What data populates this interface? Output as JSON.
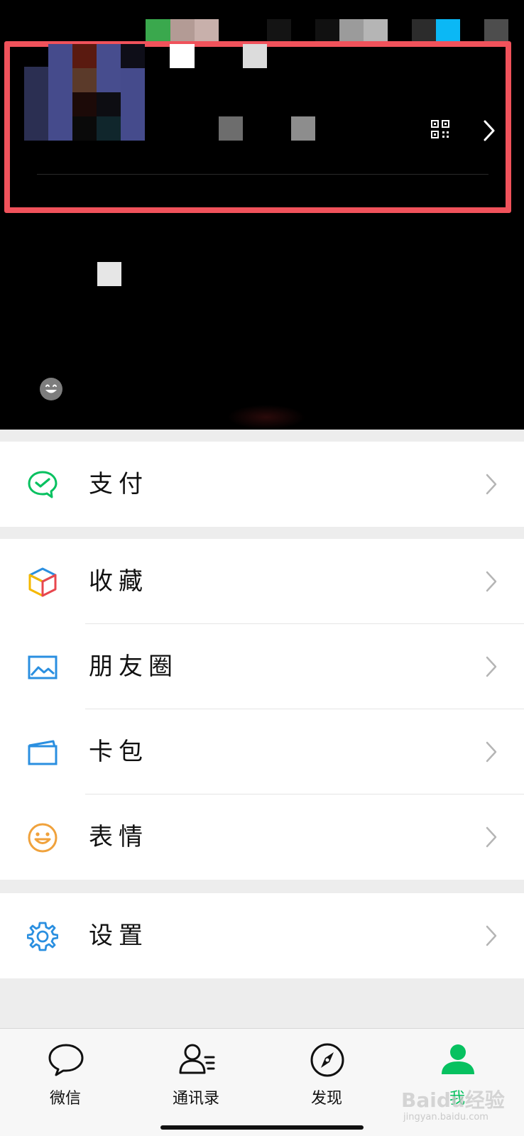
{
  "menu": {
    "pay": {
      "label": "支付",
      "icon": "wechat-pay-icon"
    },
    "favorites": {
      "label": "收藏",
      "icon": "favorites-cube-icon"
    },
    "moments": {
      "label": "朋友圈",
      "icon": "moments-picture-icon"
    },
    "cards": {
      "label": "卡包",
      "icon": "card-wallet-icon"
    },
    "stickers": {
      "label": "表情",
      "icon": "sticker-smile-icon"
    },
    "settings": {
      "label": "设置",
      "icon": "settings-gear-icon"
    }
  },
  "tabbar": {
    "tabs": [
      {
        "label": "微信",
        "icon": "chat-bubble-icon",
        "active": false
      },
      {
        "label": "通讯录",
        "icon": "contacts-icon",
        "active": false
      },
      {
        "label": "发现",
        "icon": "discover-compass-icon",
        "active": false
      },
      {
        "label": "我",
        "icon": "me-person-icon",
        "active": true
      }
    ]
  },
  "watermark": {
    "text": "Baidu经验",
    "sub": "jingyan.baidu.com"
  },
  "colors": {
    "accent_green": "#07c160",
    "highlight_red": "#f0525b",
    "header_bg": "#000000",
    "page_bg": "#ededed"
  }
}
